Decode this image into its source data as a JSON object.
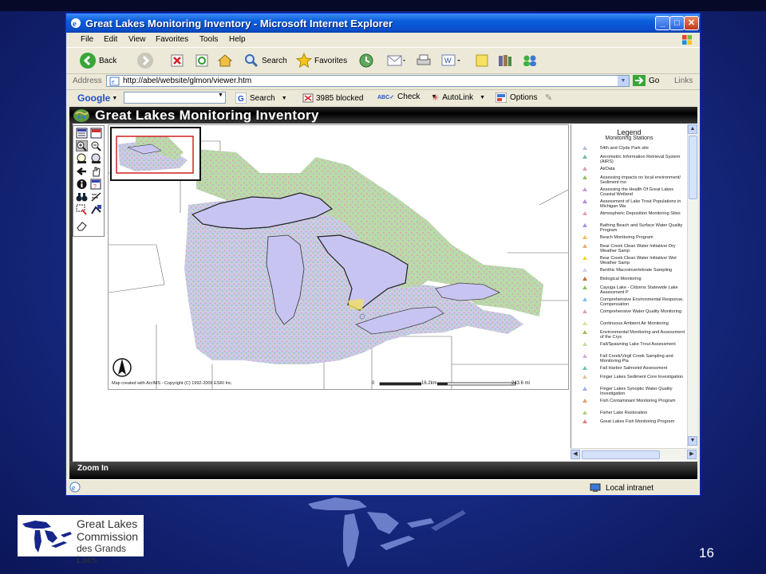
{
  "window": {
    "title": "Great Lakes Monitoring Inventory - Microsoft Internet Explorer",
    "controls": [
      "_",
      "□",
      "✕"
    ]
  },
  "menu": [
    "File",
    "Edit",
    "View",
    "Favorites",
    "Tools",
    "Help"
  ],
  "toolbar": {
    "back": "Back",
    "search": "Search",
    "favorites": "Favorites"
  },
  "address": {
    "label": "Address",
    "url": "http://abel/website/glmon/viewer.htm",
    "go": "Go",
    "links": "Links"
  },
  "google_bar": {
    "brand": "Google",
    "search": "Search",
    "blocked": "3985 blocked",
    "check": "Check",
    "autolink": "AutoLink",
    "options": "Options"
  },
  "app": {
    "title": "Great Lakes Monitoring Inventory",
    "map_credit": "Map created with ArcIMS - Copyright (C) 1992-2006 ESRI Inc.",
    "scale_start": "0",
    "scale_mid": "16.2km",
    "scale_end": "243.6 mi",
    "status": "Zoom In"
  },
  "legend": {
    "title": "Legend",
    "subtitle": "Monitoring Stations",
    "items": [
      {
        "label": "54th and Clyde Park site",
        "color": "#b7c0d8"
      },
      {
        "label": "Aerometric Information Retrieval System (AIRS)",
        "color": "#7fb4a8"
      },
      {
        "label": "AirData",
        "color": "#d8a0a0"
      },
      {
        "label": "Assessing impacts on local environment/ Sediment mo",
        "color": "#8fbf6a"
      },
      {
        "label": "Assessing the Health Of Great Lakes Coastal Wetland",
        "color": "#c89ad8"
      },
      {
        "label": "Assessment of Lake Trout Populations in Michigan Wa",
        "color": "#b08fd0"
      },
      {
        "label": "Atmospheric Deposition Monitoring Sites",
        "color": "#e0a0b8"
      },
      {
        "label": "Bathing Beach and Surface Water Quality Program",
        "color": "#9a9ad8"
      },
      {
        "label": "Beach Monitoring Program",
        "color": "#e8c060"
      },
      {
        "label": "Bear Creek Clean Water Initiative/ Dry Weather Samp",
        "color": "#e0b080"
      },
      {
        "label": "Bear Creek Clean Water Initiative/ Wet Weather Samp",
        "color": "#e8d840"
      },
      {
        "label": "Benthic Macroinvertebrate Sampling",
        "color": "#d0d0e8"
      },
      {
        "label": "Biological Monitoring",
        "color": "#c07040"
      },
      {
        "label": "Cayuga Lake - Citizens Statewide Lake Assessment P",
        "color": "#8fbf6a"
      },
      {
        "label": "Comprehensive Environmental Response, Compensation",
        "color": "#88c0e0"
      },
      {
        "label": "Comprehensive Water Quality Monitoring",
        "color": "#e0a0c0"
      },
      {
        "label": "Continuous Ambient Air Monitoring",
        "color": "#d8e0a0"
      },
      {
        "label": "Environmental Monitoring and Assessment of the Crys",
        "color": "#a0c060"
      },
      {
        "label": "Fall/Spawning Lake Trout Assessment",
        "color": "#c0e0a0"
      },
      {
        "label": "Fall Creek/Virgil Creek Sampling and Monitoring Pla",
        "color": "#d0b0e0"
      },
      {
        "label": "Fall Harbor Salmonid Assessment",
        "color": "#70c0b0"
      },
      {
        "label": "Finger Lakes Sediment Core Investigation",
        "color": "#e0c0a0"
      },
      {
        "label": "Finger Lakes Synoptic Water Quality Investigation",
        "color": "#a0b0e0"
      },
      {
        "label": "Fish Contaminant Monitoring Program",
        "color": "#e0a070"
      },
      {
        "label": "Fisher Lake Restoration",
        "color": "#b0d080"
      },
      {
        "label": "Great Lakes Fish Monitoring Program",
        "color": "#e08080"
      }
    ]
  },
  "ie_status": {
    "zone": "Local intranet"
  },
  "slide": {
    "org_line1": "Great Lakes",
    "org_line2": "Commission",
    "org_line3": "des Grands Lacs",
    "page_number": "16"
  }
}
